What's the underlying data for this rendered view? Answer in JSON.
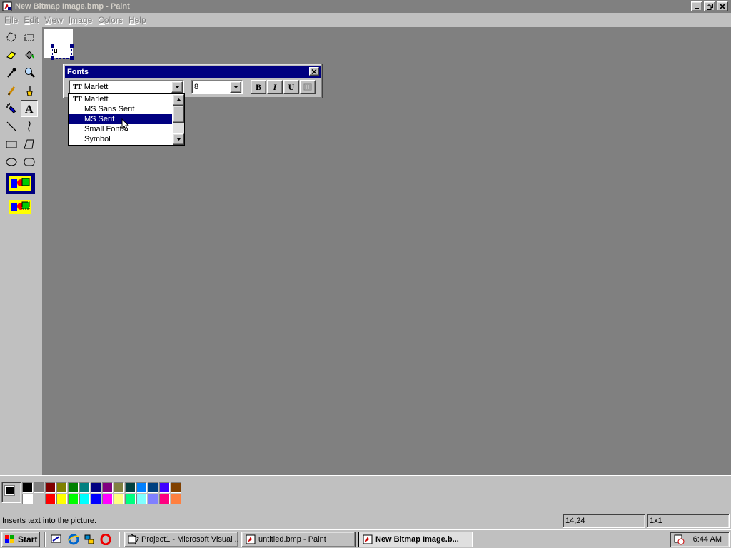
{
  "window": {
    "title": "New Bitmap Image.bmp - Paint"
  },
  "menu": [
    "File",
    "Edit",
    "View",
    "Image",
    "Colors",
    "Help"
  ],
  "toolbox": {
    "tools": [
      "free-select",
      "select",
      "eraser",
      "fill",
      "pick-color",
      "magnifier",
      "pencil",
      "brush",
      "airbrush",
      "text",
      "line",
      "curve",
      "rectangle",
      "polygon",
      "ellipse",
      "rounded-rectangle"
    ],
    "selected_tool": "text"
  },
  "fonts_toolbar": {
    "title": "Fonts",
    "font_name": "Marlett",
    "font_size": "8",
    "bold_label": "B",
    "italic_label": "I",
    "underline_label": "U",
    "font_list": [
      "Marlett",
      "MS Sans Serif",
      "MS Serif",
      "Small Fonts",
      "Symbol"
    ],
    "selected_font": "MS Serif"
  },
  "palette": {
    "top_row": [
      "#000000",
      "#808080",
      "#800000",
      "#808000",
      "#008000",
      "#008080",
      "#000080",
      "#800080",
      "#808040",
      "#004040",
      "#0080ff",
      "#004080",
      "#4000ff",
      "#804000"
    ],
    "bottom_row": [
      "#ffffff",
      "#c0c0c0",
      "#ff0000",
      "#ffff00",
      "#00ff00",
      "#00ffff",
      "#0000ff",
      "#ff00ff",
      "#ffff80",
      "#00ff80",
      "#80ffff",
      "#8080ff",
      "#ff0080",
      "#ff8040"
    ],
    "foreground": "#000000",
    "background": "#ffffff"
  },
  "status": {
    "message": "Inserts text into the picture.",
    "coordinates": "14,24",
    "size": "1x1"
  },
  "taskbar": {
    "start_label": "Start",
    "tasks": [
      {
        "label": "Project1 - Microsoft Visual ...",
        "active": false
      },
      {
        "label": "untitled.bmp - Paint",
        "active": false
      },
      {
        "label": "New Bitmap Image.b...",
        "active": true
      }
    ],
    "clock": "6:44 AM"
  }
}
